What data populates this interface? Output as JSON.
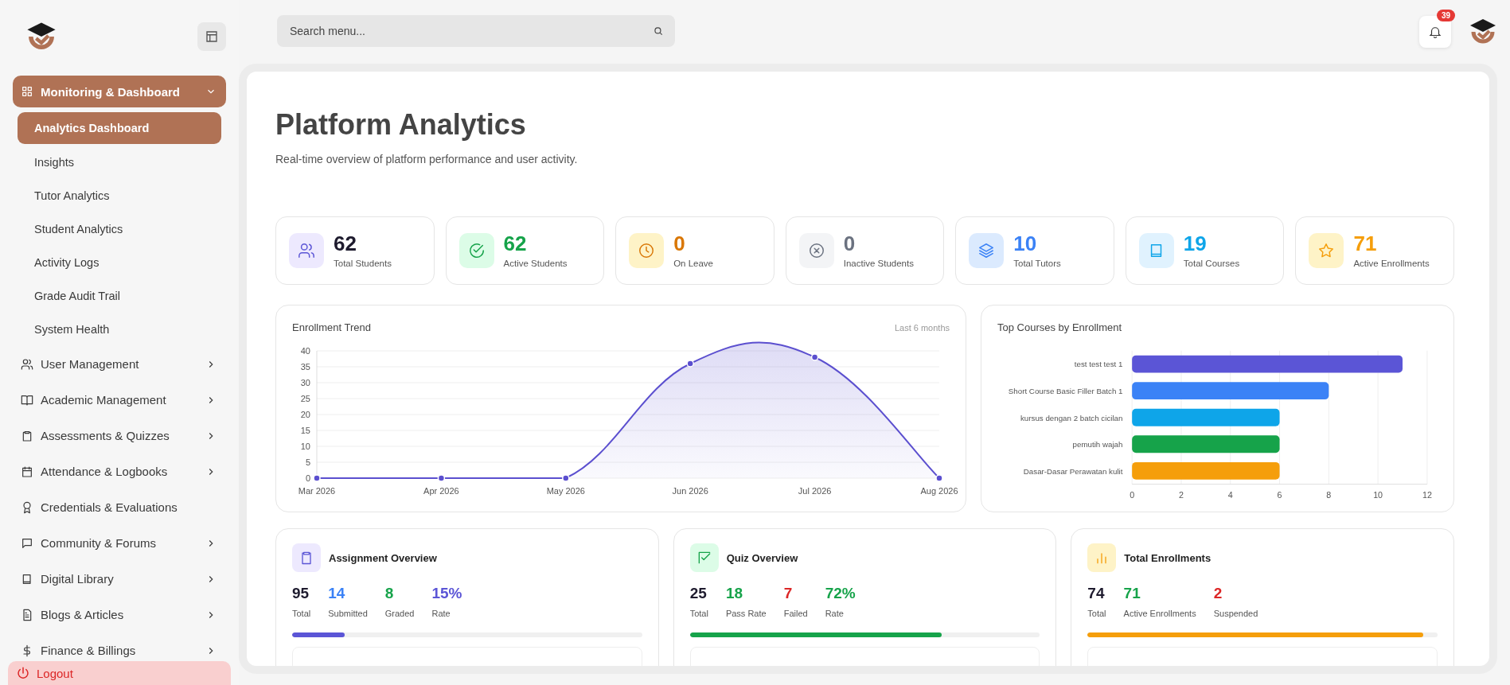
{
  "sidebar": {
    "groups": [
      {
        "label": "Monitoring & Dashboard",
        "expandable": true,
        "expanded": true,
        "children": [
          {
            "label": "Analytics Dashboard",
            "selected": true
          },
          {
            "label": "Insights",
            "selected": false
          },
          {
            "label": "Tutor Analytics",
            "selected": false
          },
          {
            "label": "Student Analytics",
            "selected": false
          },
          {
            "label": "Activity Logs",
            "selected": false
          },
          {
            "label": "Grade Audit Trail",
            "selected": false
          },
          {
            "label": "System Health",
            "selected": false
          }
        ]
      },
      {
        "label": "User Management",
        "expandable": true,
        "expanded": false
      },
      {
        "label": "Academic Management",
        "expandable": true,
        "expanded": false
      },
      {
        "label": "Assessments & Quizzes",
        "expandable": true,
        "expanded": false
      },
      {
        "label": "Attendance & Logbooks",
        "expandable": true,
        "expanded": false
      },
      {
        "label": "Credentials & Evaluations",
        "expandable": false,
        "expanded": false
      },
      {
        "label": "Community & Forums",
        "expandable": true,
        "expanded": false
      },
      {
        "label": "Digital Library",
        "expandable": true,
        "expanded": false
      },
      {
        "label": "Blogs & Articles",
        "expandable": true,
        "expanded": false
      },
      {
        "label": "Finance & Billings",
        "expandable": true,
        "expanded": false
      }
    ],
    "logout": "Logout"
  },
  "header": {
    "search": {
      "placeholder": "Search menu..."
    },
    "notifications": "39"
  },
  "page": {
    "title": "Platform Analytics",
    "subtitle": "Real-time overview of platform performance and user activity."
  },
  "stats": [
    {
      "value": "62",
      "label": "Total Students",
      "color": "#1e1b2e"
    },
    {
      "value": "62",
      "label": "Active Students",
      "color": "#16a34a"
    },
    {
      "value": "0",
      "label": "On Leave",
      "color": "#d97706"
    },
    {
      "value": "0",
      "label": "Inactive Students",
      "color": "#6b7280"
    },
    {
      "value": "10",
      "label": "Total Tutors",
      "color": "#3b82f6"
    },
    {
      "value": "19",
      "label": "Total Courses",
      "color": "#0ea5e9"
    },
    {
      "value": "71",
      "label": "Active Enrollments",
      "color": "#f59e0b"
    }
  ],
  "enrollment_trend": {
    "title": "Enrollment Trend",
    "range": "Last 6 months",
    "chart_data": {
      "type": "area",
      "categories": [
        "Mar 2026",
        "Apr 2026",
        "May 2026",
        "Jun 2026",
        "Jul 2026",
        "Aug 2026"
      ],
      "series": [
        {
          "color": "#5b4fcf",
          "values": [
            0,
            0,
            0,
            36,
            38,
            0
          ]
        }
      ],
      "grid": true,
      "ylim": [
        0,
        40
      ],
      "yticks": [
        0,
        5,
        10,
        15,
        20,
        25,
        30,
        35,
        40
      ]
    }
  },
  "top_courses": {
    "title": "Top Courses by Enrollment",
    "chart_data": {
      "type": "bar",
      "orientation": "horizontal",
      "categories": [
        "test test test 1",
        "Short Course Basic Filler Batch 1",
        "kursus dengan 2 batch cicilan",
        "pemutih wajah",
        "Dasar-Dasar Perawatan kulit"
      ],
      "series": [
        {
          "values": [
            11,
            8,
            6,
            6,
            6
          ]
        }
      ],
      "colors": [
        "#5b55d6",
        "#3b82f6",
        "#0ea5e9",
        "#16a34a",
        "#f59e0b"
      ],
      "grid": true,
      "xlim": [
        0,
        12
      ],
      "xticks": [
        0,
        2,
        4,
        6,
        8,
        10,
        12
      ]
    }
  },
  "overviews": [
    {
      "title": "Assignment Overview",
      "color": "#5b55d6",
      "level": 0.15,
      "stats": [
        {
          "value": "95",
          "label": "Total",
          "color": "#1e1b2e"
        },
        {
          "value": "14",
          "label": "Submitted",
          "color": "#3b82f6"
        },
        {
          "value": "8",
          "label": "Graded",
          "color": "#16a34a"
        },
        {
          "value": "15%",
          "label": "Rate",
          "color": "#5b55d6"
        }
      ]
    },
    {
      "title": "Quiz Overview",
      "color": "#16a34a",
      "level": 0.72,
      "stats": [
        {
          "value": "25",
          "label": "Total",
          "color": "#1e1b2e"
        },
        {
          "value": "18",
          "label": "Pass Rate",
          "color": "#16a34a"
        },
        {
          "value": "7",
          "label": "Failed",
          "color": "#dc2626"
        },
        {
          "value": "72%",
          "label": "Rate",
          "color": "#16a34a"
        }
      ]
    },
    {
      "title": "Total Enrollments",
      "color": "#f59e0b",
      "level": 0.96,
      "stats": [
        {
          "value": "74",
          "label": "Total",
          "color": "#1e1b2e"
        },
        {
          "value": "71",
          "label": "Active Enrollments",
          "color": "#16a34a"
        },
        {
          "value": "2",
          "label": "Suspended",
          "color": "#dc2626"
        }
      ]
    }
  ]
}
